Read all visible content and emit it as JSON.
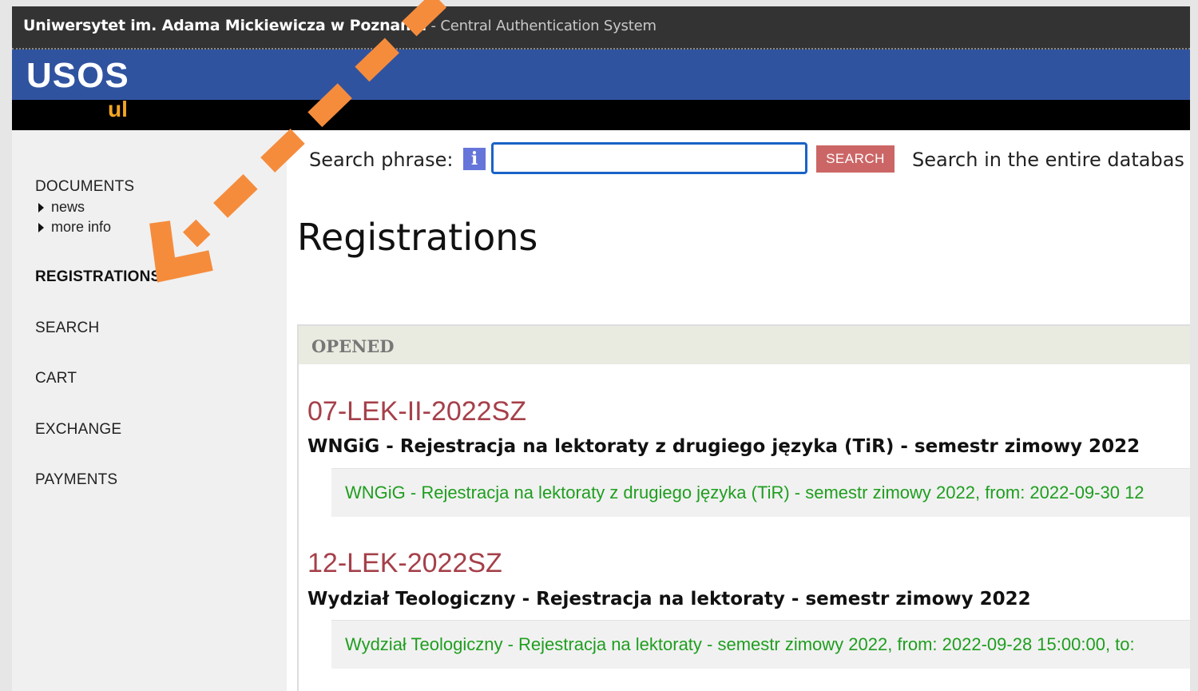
{
  "colors": {
    "header_dark": "#333333",
    "header_blue": "#3053a0",
    "logo_orange": "#f5a623",
    "search_button": "#cc6666",
    "code_red": "#a5404a",
    "detail_green": "#1f9e1f",
    "annotation_arrow": "#f58c3c"
  },
  "header": {
    "university": "Uniwersytet im. Adama Mickiewicza w Poznaniu",
    "system": " - Central Authentication System",
    "logo_main": "USOS",
    "logo_sub": "ul"
  },
  "sidebar": {
    "documents": "DOCUMENTS",
    "news": "news",
    "more_info": "more info",
    "registrations": "REGISTRATIONS",
    "search": "SEARCH",
    "cart": "CART",
    "exchange": "EXCHANGE",
    "payments": "PAYMENTS"
  },
  "search": {
    "label": "Search phrase:",
    "info_icon": "i",
    "input_value": "",
    "button": "SEARCH",
    "scope": "Search in the entire databas"
  },
  "main": {
    "title": "Registrations",
    "section": "OPENED",
    "registrations": [
      {
        "code": "07-LEK-II-2022SZ",
        "name": "WNGiG - Rejestracja na lektoraty z drugiego języka (TiR) - semestr zimowy 2022",
        "detail": "WNGiG - Rejestracja na lektoraty z drugiego języka (TiR) - semestr zimowy 2022, from: 2022-09-30 12"
      },
      {
        "code": "12-LEK-2022SZ",
        "name": "Wydział Teologiczny - Rejestracja na lektoraty - semestr zimowy 2022",
        "detail": "Wydział Teologiczny - Rejestracja na lektoraty - semestr zimowy 2022, from: 2022-09-28 15:00:00, to:"
      }
    ]
  },
  "annotation": {
    "icon": "dashed-arrow-icon"
  }
}
